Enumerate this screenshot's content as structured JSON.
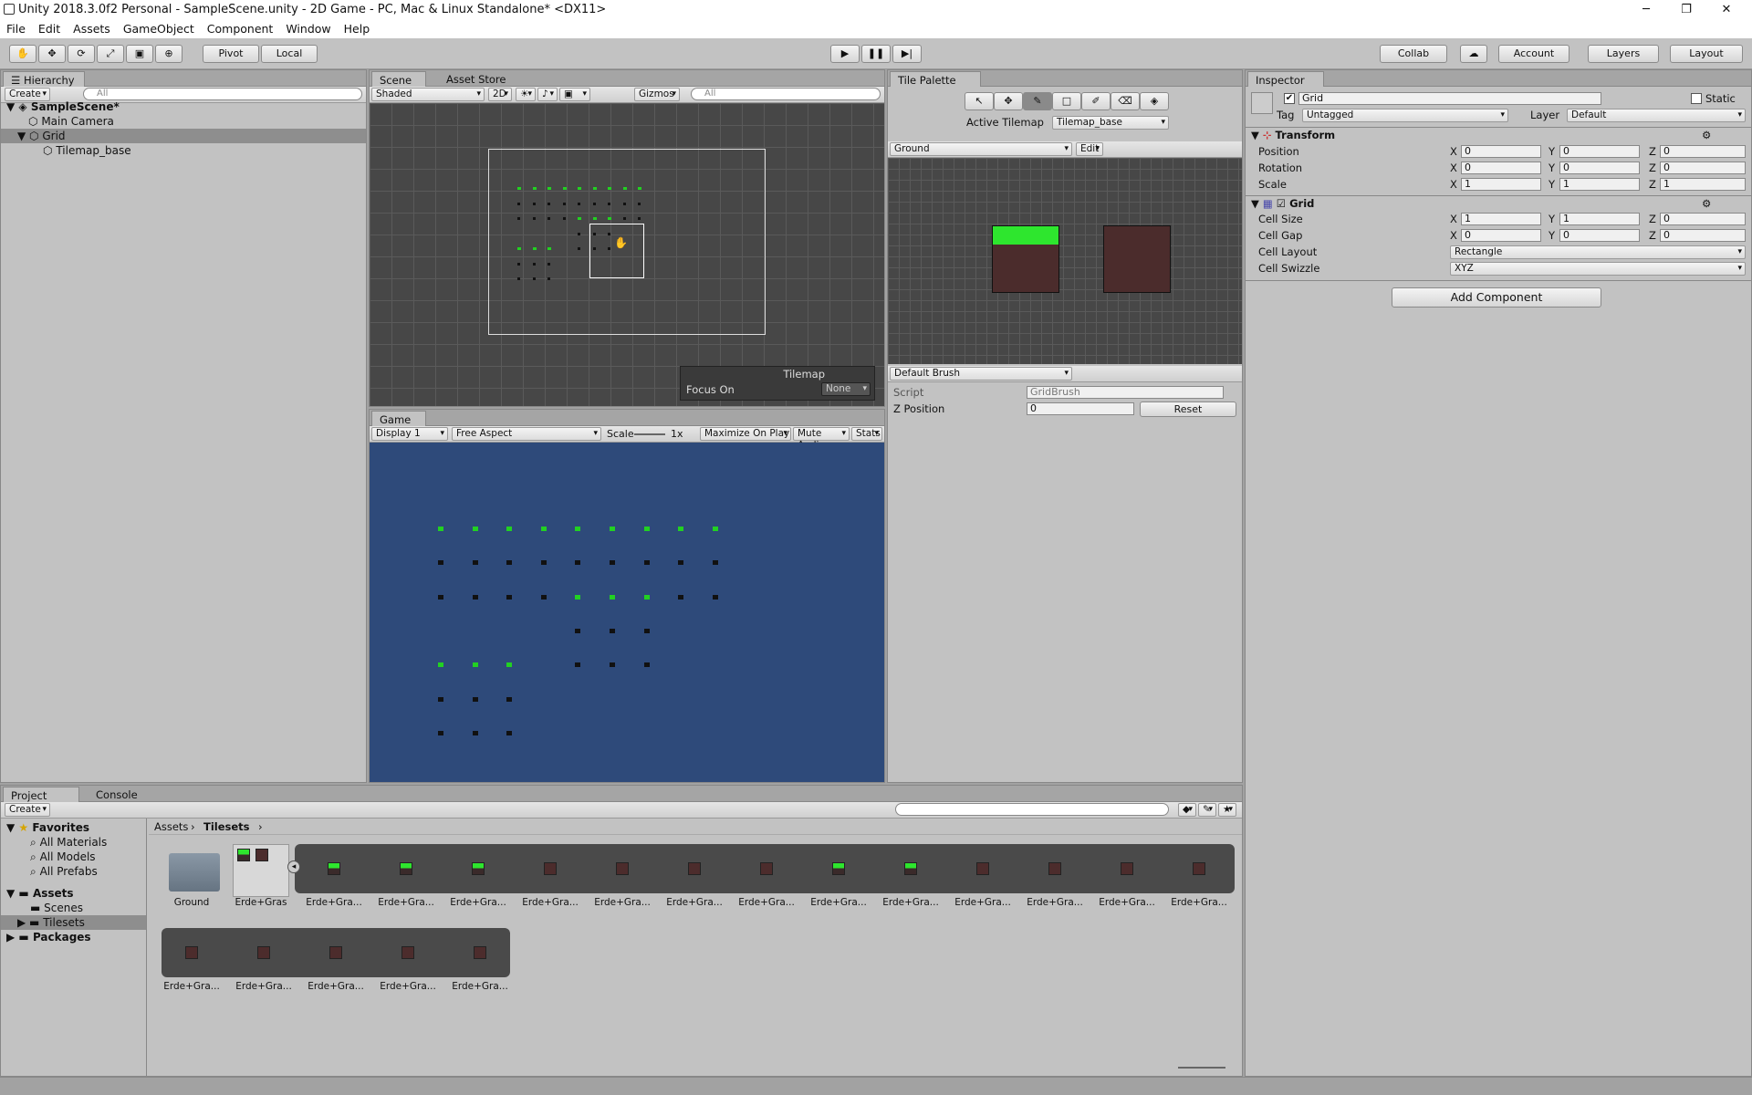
{
  "window": {
    "title": "Unity 2018.3.0f2 Personal - SampleScene.unity - 2D Game - PC, Mac & Linux Standalone* <DX11>",
    "minimize": "─",
    "restore": "❐",
    "close": "✕"
  },
  "menu": [
    "File",
    "Edit",
    "Assets",
    "GameObject",
    "Component",
    "Window",
    "Help"
  ],
  "toolbar": {
    "pivot": "Pivot",
    "local": "Local",
    "collab": "Collab",
    "account": "Account",
    "layers": "Layers",
    "layout": "Layout",
    "tools": [
      "hand-tool-icon",
      "move-tool-icon",
      "rotate-tool-icon",
      "scale-tool-icon",
      "rect-tool-icon",
      "transform-tool-icon"
    ],
    "tool_glyphs": [
      "✋",
      "✥",
      "⟳",
      "⤢",
      "▣",
      "⊕"
    ],
    "play": "▶",
    "pause": "❚❚",
    "step": "▶|"
  },
  "hierarchy": {
    "tab": "Hierarchy",
    "create": "Create",
    "search": "All",
    "scene": "SampleScene*",
    "items": [
      {
        "label": "Main Camera"
      },
      {
        "label": "Grid"
      },
      {
        "label": "Tilemap_base"
      }
    ]
  },
  "scene": {
    "tab": "Scene",
    "store_tab": "Asset Store",
    "shading": "Shaded",
    "mode2d": "2D",
    "gizmos": "Gizmos",
    "search": "All",
    "overlay_title": "Tilemap",
    "focus_label": "Focus On",
    "focus_value": "None"
  },
  "game": {
    "tab": "Game",
    "display": "Display 1",
    "aspect": "Free Aspect",
    "scale_label": "Scale",
    "scale_value": "1x",
    "maximize": "Maximize On Play",
    "mute": "Mute Audio",
    "stats": "Stats",
    "background": "#2e4a7a"
  },
  "palette": {
    "tab": "Tile Palette",
    "active_label": "Active Tilemap",
    "active_value": "Tilemap_base",
    "palette_name": "Ground",
    "edit": "Edit",
    "brush": "Default Brush",
    "script_label": "Script",
    "script_value": "GridBrush",
    "zpos_label": "Z Position",
    "zpos_value": "0",
    "reset": "Reset"
  },
  "inspector": {
    "tab": "Inspector",
    "name": "Grid",
    "static": "Static",
    "tag_label": "Tag",
    "tag_value": "Untagged",
    "layer_label": "Layer",
    "layer_value": "Default",
    "transform": {
      "title": "Transform",
      "rows": [
        {
          "label": "Position",
          "x": "0",
          "y": "0",
          "z": "0"
        },
        {
          "label": "Rotation",
          "x": "0",
          "y": "0",
          "z": "0"
        },
        {
          "label": "Scale",
          "x": "1",
          "y": "1",
          "z": "1"
        }
      ]
    },
    "grid": {
      "title": "Grid",
      "cell_size": {
        "label": "Cell Size",
        "x": "1",
        "y": "1",
        "z": "0"
      },
      "cell_gap": {
        "label": "Cell Gap",
        "x": "0",
        "y": "0",
        "z": "0"
      },
      "cell_layout": {
        "label": "Cell Layout",
        "value": "Rectangle"
      },
      "cell_swizzle": {
        "label": "Cell Swizzle",
        "value": "XYZ"
      }
    },
    "add_component": "Add Component"
  },
  "project": {
    "tab": "Project",
    "console_tab": "Console",
    "create": "Create",
    "favorites": "Favorites",
    "fav_items": [
      "All Materials",
      "All Models",
      "All Prefabs"
    ],
    "assets": "Assets",
    "asset_items": [
      "Scenes",
      "Tilesets"
    ],
    "packages": "Packages",
    "breadcrumb": [
      "Assets",
      "Tilesets"
    ],
    "folder": "Ground",
    "sheet": "Erde+Gras",
    "tiles_row1": [
      "Erde+Gra...",
      "Erde+Gra...",
      "Erde+Gra...",
      "Erde+Gra...",
      "Erde+Gra...",
      "Erde+Gra...",
      "Erde+Gra...",
      "Erde+Gra...",
      "Erde+Gra...",
      "Erde+Gra...",
      "Erde+Gra...",
      "Erde+Gra...",
      "Erde+Gra..."
    ],
    "tiles_row2": [
      "Erde+Gra...",
      "Erde+Gra...",
      "Erde+Gra...",
      "Erde+Gra...",
      "Erde+Gra..."
    ]
  }
}
